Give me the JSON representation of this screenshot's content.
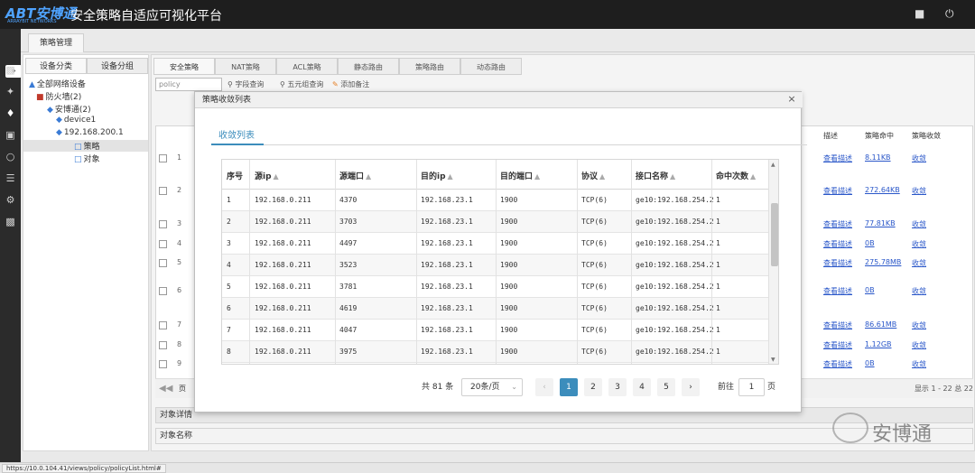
{
  "app": {
    "logo_text": "ABT安博通",
    "logo_sub": "ARRAYBIT NETWORKS",
    "title": "安全策略自适应可视化平台"
  },
  "header_icons": {
    "chat": "chat-icon",
    "power": "power-icon"
  },
  "main_tab": "策略管理",
  "left_panel": {
    "tabs": [
      "设备分类",
      "设备分组"
    ],
    "tree": [
      {
        "label": "全部网络设备",
        "level": 0
      },
      {
        "label": "防火墙(2)",
        "level": 1
      },
      {
        "label": "安博通(2)",
        "level": 2
      },
      {
        "label": "device1",
        "level": 3
      },
      {
        "label": "192.168.200.1",
        "level": 3
      },
      {
        "label": "策略",
        "level": 4
      },
      {
        "label": "对象",
        "level": 4
      }
    ]
  },
  "right_panel": {
    "tabs": [
      "安全策略",
      "NAT策略",
      "ACL策略",
      "静态路由",
      "策略路由",
      "动态路由"
    ],
    "filter_value": "policy",
    "filter_buttons": [
      "字段查询",
      "五元组查询",
      "添加备注"
    ],
    "bg_headers": [
      "描述",
      "策略命中",
      "策略收敛"
    ],
    "bg_rows": [
      {
        "num": "1",
        "desc": "查看描述",
        "hit": "8.11KB",
        "conv": "收敛"
      },
      {
        "num": "2",
        "desc": "查看描述",
        "hit": "272.64KB",
        "conv": "收敛"
      },
      {
        "num": "3",
        "desc": "查看描述",
        "hit": "77.81KB",
        "conv": "收敛"
      },
      {
        "num": "4",
        "desc": "查看描述",
        "hit": "0B",
        "conv": "收敛"
      },
      {
        "num": "5",
        "desc": "查看描述",
        "hit": "275.78MB",
        "conv": "收敛"
      },
      {
        "num": "6",
        "desc": "查看描述",
        "hit": "0B",
        "conv": "收敛"
      },
      {
        "num": "7",
        "desc": "查看描述",
        "hit": "86.61MB",
        "conv": "收敛"
      },
      {
        "num": "8",
        "desc": "查看描述",
        "hit": "1.12GB",
        "conv": "收敛"
      },
      {
        "num": "9",
        "desc": "查看描述",
        "hit": "0B",
        "conv": "收敛"
      }
    ],
    "pager_left": "页",
    "pager_right": "显示 1 - 22 总 22",
    "section1": "对象详情",
    "section2": "对象名称"
  },
  "dialog": {
    "title": "策略收敛列表",
    "tab": "收敛列表",
    "columns": [
      "序号",
      "源ip",
      "源端口",
      "目的ip",
      "目的端口",
      "协议",
      "接口名称",
      "命中次数"
    ],
    "rows": [
      [
        "1",
        "192.168.0.211",
        "4370",
        "192.168.23.1",
        "1900",
        "TCP(6)",
        "ge10:192.168.254.2",
        "1"
      ],
      [
        "2",
        "192.168.0.211",
        "3703",
        "192.168.23.1",
        "1900",
        "TCP(6)",
        "ge10:192.168.254.2",
        "1"
      ],
      [
        "3",
        "192.168.0.211",
        "4497",
        "192.168.23.1",
        "1900",
        "TCP(6)",
        "ge10:192.168.254.2",
        "1"
      ],
      [
        "4",
        "192.168.0.211",
        "3523",
        "192.168.23.1",
        "1900",
        "TCP(6)",
        "ge10:192.168.254.2",
        "1"
      ],
      [
        "5",
        "192.168.0.211",
        "3781",
        "192.168.23.1",
        "1900",
        "TCP(6)",
        "ge10:192.168.254.2",
        "1"
      ],
      [
        "6",
        "192.168.0.211",
        "4619",
        "192.168.23.1",
        "1900",
        "TCP(6)",
        "ge10:192.168.254.2",
        "1"
      ],
      [
        "7",
        "192.168.0.211",
        "4047",
        "192.168.23.1",
        "1900",
        "TCP(6)",
        "ge10:192.168.254.2",
        "1"
      ],
      [
        "8",
        "192.168.0.211",
        "3975",
        "192.168.23.1",
        "1900",
        "TCP(6)",
        "ge10:192.168.254.2",
        "1"
      ]
    ],
    "pagination": {
      "total_prefix": "共",
      "total": "81",
      "total_suffix": "条",
      "page_size": "20条/页",
      "pages": [
        "1",
        "2",
        "3",
        "4",
        "5"
      ],
      "active_page": "1",
      "goto_label": "前往",
      "goto_value": "1",
      "goto_suffix": "页"
    }
  },
  "watermark": "安博通",
  "status_url": "https://10.0.104.41/views/policy/policyList.html#",
  "colors": {
    "accent": "#3c8dbc",
    "header_bg": "#1e1e1e",
    "link": "#2a57c9",
    "logo": "#4fa3ff"
  }
}
